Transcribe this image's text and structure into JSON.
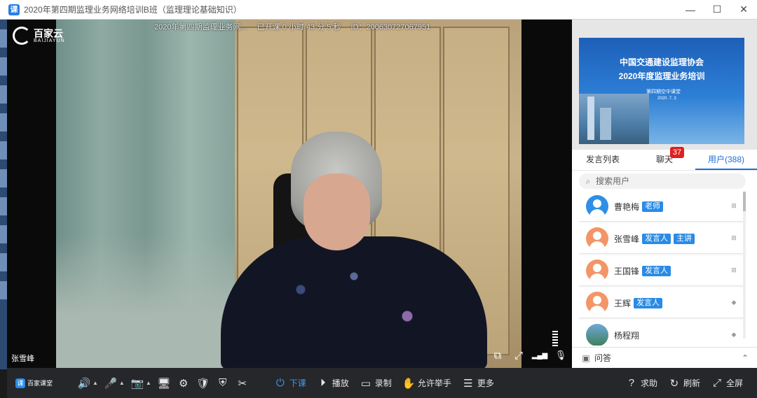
{
  "window": {
    "title": "2020年第四期监理业务网络培训B班（监理理论基础知识）",
    "app_icon": "课",
    "minimize": "—",
    "maximize": "☐",
    "close": "✕"
  },
  "video": {
    "brand_cn": "百家云",
    "brand_en": "BAIJIAYUN",
    "course_name": "2020年第四期监理业务网...",
    "elapsed": "已开课 0 小时 43 分 5 秒",
    "room_id": "ID：200630727067951",
    "speaker_name": "张雪峰",
    "icons": {
      "screen_swap": "⧉",
      "fullscreen": "⤢",
      "signal": "▂▄▆",
      "mic": "🎙"
    }
  },
  "slide": {
    "title_line1": "中国交通建设监理协会",
    "title_line2": "2020年度监理业务培训",
    "subtitle": "第四期空中课堂",
    "date": "2020. 7. 3"
  },
  "tabs": [
    {
      "label": "发言列表"
    },
    {
      "label": "聊天",
      "badge": "37"
    },
    {
      "label": "用户(388)"
    }
  ],
  "search": {
    "placeholder": "搜索用户"
  },
  "users": [
    {
      "name": "曹艳梅",
      "tags": [
        "老师"
      ],
      "avatar": "blue",
      "device": "windows"
    },
    {
      "name": "张雪峰",
      "tags": [
        "发言人",
        "主讲"
      ],
      "avatar": "orange",
      "device": "windows"
    },
    {
      "name": "王国锋",
      "tags": [
        "发言人"
      ],
      "avatar": "orange",
      "device": "windows"
    },
    {
      "name": "王辉",
      "tags": [
        "发言人"
      ],
      "avatar": "orange",
      "device": "android"
    },
    {
      "name": "杨程翔",
      "tags": [],
      "avatar": "photo",
      "device": "android"
    }
  ],
  "qa": {
    "label": "问答",
    "expand": "⌃"
  },
  "toolbar": {
    "brand_mark": "课",
    "brand_text": "百家课堂",
    "buttons": [
      {
        "name": "speaker",
        "icon": "🔊",
        "caret": true
      },
      {
        "name": "mic-off",
        "icon": "🎤",
        "caret": true,
        "color": "red"
      },
      {
        "name": "camera-off",
        "icon": "📷",
        "caret": true,
        "color": "red"
      },
      {
        "name": "screen-share",
        "icon": "🖥"
      },
      {
        "name": "settings",
        "icon": "⚙"
      },
      {
        "name": "shield",
        "icon": "🛡"
      },
      {
        "name": "shield-check",
        "icon": "⛨"
      },
      {
        "name": "scissors",
        "icon": "✂"
      }
    ],
    "end_class": "下课",
    "play": "播放",
    "record": "录制",
    "raise_hand": "允许举手",
    "more": "更多",
    "help": "求助",
    "refresh": "刷新",
    "fullscreen": "全屏"
  },
  "colors": {
    "accent": "#1e6fd6",
    "tag_blue": "#2a8be6",
    "badge_red": "#e02020",
    "toolbar_bg": "#25272b"
  }
}
